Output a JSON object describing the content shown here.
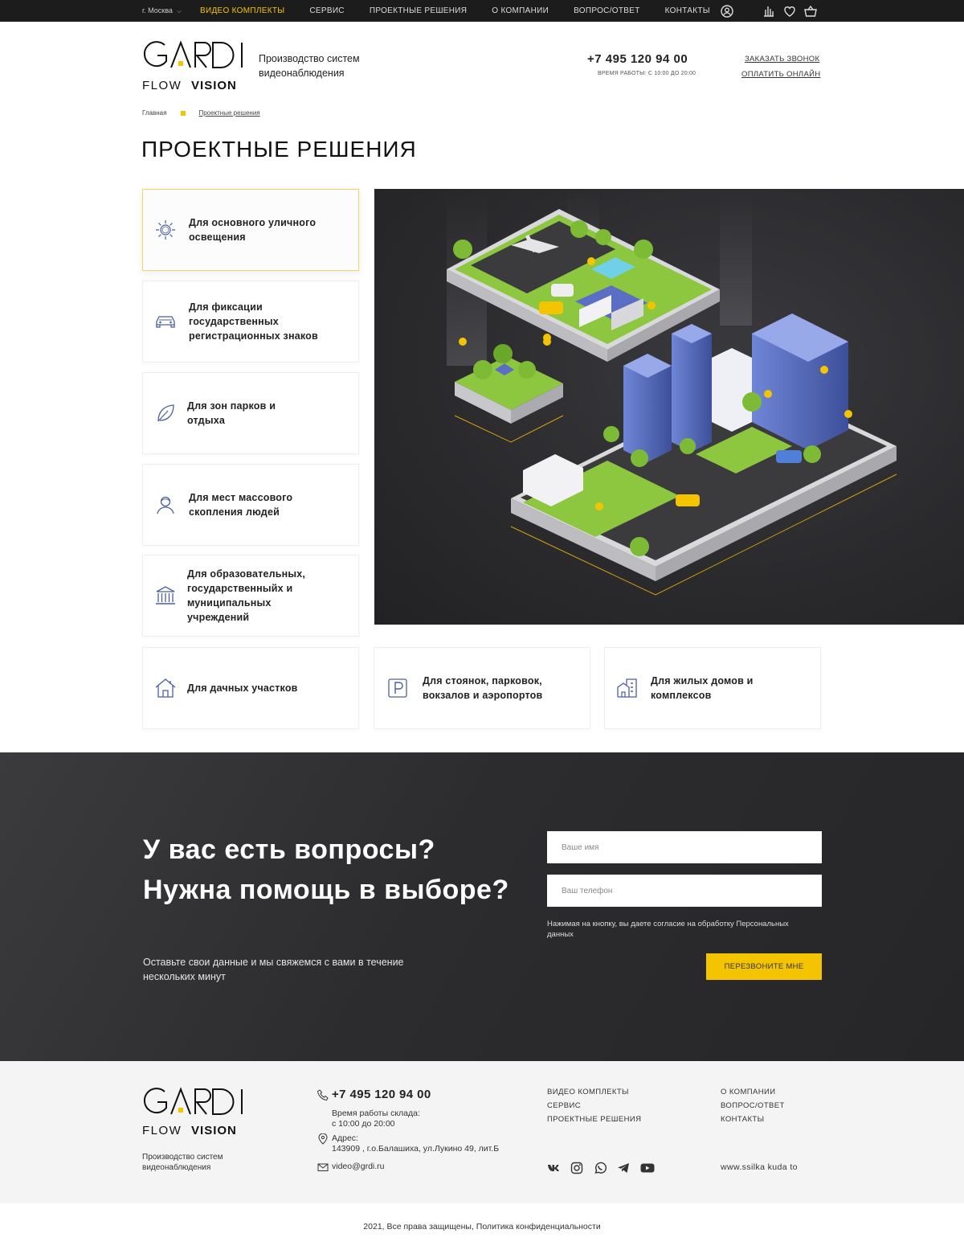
{
  "topbar": {
    "city": "г. Москва",
    "nav": [
      "ВИДЕО КОМПЛЕКТЫ",
      "СЕРВИС",
      "ПРОЕКТНЫЕ РЕШЕНИЯ",
      "О КОМПАНИИ",
      "ВОПРОС/ОТВЕТ",
      "КОНТАКТЫ"
    ],
    "active_color": "#f5c400"
  },
  "header": {
    "logo_text": "GARDI",
    "logo_flow": "FLOW",
    "logo_vision": "VISION",
    "tagline_line1": "Производство систем",
    "tagline_line2": "видеонаблюдения",
    "phone": "+7 495 120 94 00",
    "hours": "ВРЕМЯ РАБОТЫ: С 10:00 ДО 20:00",
    "callback_link": "ЗАКАЗАТЬ ЗВОНОК",
    "pay_link": "ОПЛАТИТЬ ОНЛАЙН"
  },
  "breadcrumb": {
    "home": "Главная",
    "current": "Проектные решения"
  },
  "page_title": "ПРОЕКТНЫЕ РЕШЕНИЯ",
  "solutions": [
    {
      "icon": "sun-icon",
      "label": "Для основного уличного освещения"
    },
    {
      "icon": "car-icon",
      "label": "Для фиксации государственных регистрационных знаков"
    },
    {
      "icon": "leaf-icon",
      "label": "Для зон парков и отдыха"
    },
    {
      "icon": "person-icon",
      "label": "Для мест массового скопления людей"
    },
    {
      "icon": "institution-icon",
      "label": "Для образовательных, государственныйх и муниципальных учреждений"
    },
    {
      "icon": "house-icon",
      "label": "Для дачных участков"
    },
    {
      "icon": "parking-icon",
      "label": "Для стоянок, парковок, вокзалов и аэропортов"
    },
    {
      "icon": "apartments-icon",
      "label": "Для жилых домов и комплексов"
    }
  ],
  "contact": {
    "heading": "У вас есть вопросы? Нужна помощь в выборе?",
    "subtext": "Оставьте свои данные и мы свяжемся с вами в течение нескольких минут",
    "name_placeholder": "Ваше имя",
    "phone_placeholder": "Ваш телефон",
    "consent": "Нажимая на кнопку, вы даете согласие на обработку Персональных данных",
    "button": "ПЕРЕЗВОНИТЕ МНЕ"
  },
  "footer": {
    "tagline_line1": "Производство систем",
    "tagline_line2": "видеонаблюдения",
    "phone": "+7 495 120 94 00",
    "warehouse_hours_label": "Время работы склада:",
    "warehouse_hours": "с 10:00 до 20:00",
    "address_label": "Адрес:",
    "address": "143909 , г.о.Балашиха, ул.Лукино 49, лит.Б",
    "email": "video@grdi.ru",
    "links_col1": [
      "ВИДЕО КОМПЛЕКТЫ",
      "СЕРВИС",
      "ПРОЕКТНЫЕ РЕШЕНИЯ"
    ],
    "links_col2": [
      "О КОМПАНИИ",
      "ВОПРОС/ОТВЕТ",
      "КОНТАКТЫ"
    ],
    "social": [
      "vk-icon",
      "instagram-icon",
      "whatsapp-icon",
      "telegram-icon",
      "youtube-icon"
    ],
    "site_link": "www.ssilka kuda to",
    "copyright": "2021, Все права защищены, Политика конфиденциальности"
  },
  "colors": {
    "accent": "#f5c400",
    "icon_blue": "#4a5f9e",
    "dark_bg": "#2c2c2e"
  }
}
